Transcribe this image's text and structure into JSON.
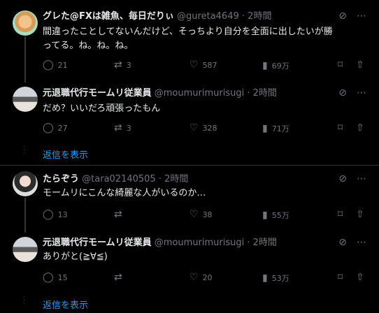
{
  "threads": [
    {
      "tweets": [
        {
          "name": "グレた@FXは雑魚、毎日だりぃ",
          "handle": "@gureta4649",
          "sep": "·",
          "time": "2時間",
          "text": "間違ったことしてないんだけど、そっちより自分を全面に出したいが勝ってる。ね。ね。ね。",
          "replies": "21",
          "retweets": "3",
          "likes": "587",
          "views": "69万"
        },
        {
          "name": "元退職代行モームリ従業員",
          "handle": "@moumurimurisugi",
          "sep": "·",
          "time": "2時間",
          "text": "だめ？いいだろ頑張ったもん",
          "replies": "27",
          "retweets": "3",
          "likes": "328",
          "views": "71万"
        }
      ],
      "show_replies": "返信を表示"
    },
    {
      "tweets": [
        {
          "name": "たらぞう",
          "handle": "@tara02140505",
          "sep": "·",
          "time": "2時間",
          "text": "モームリにこんな綺麗な人がいるのか…",
          "replies": "13",
          "retweets": "",
          "likes": "38",
          "views": "55万"
        },
        {
          "name": "元退職代行モームリ従業員",
          "handle": "@moumurimurisugi",
          "sep": "·",
          "time": "2時間",
          "text": "ありがと(≧∀≦)",
          "replies": "15",
          "retweets": "",
          "likes": "20",
          "views": "53万"
        }
      ],
      "show_replies": "返信を表示"
    }
  ],
  "icons": {
    "reply": "reply-icon",
    "retweet": "retweet-icon",
    "like": "heart-icon",
    "views": "views-icon",
    "bookmark": "bookmark-icon",
    "share": "share-icon",
    "grok": "grok-icon",
    "more": "more-icon"
  },
  "colors": {
    "background": "#000000",
    "text": "#e7e9ea",
    "muted": "#71767b",
    "accent": "#1d9bf0"
  }
}
